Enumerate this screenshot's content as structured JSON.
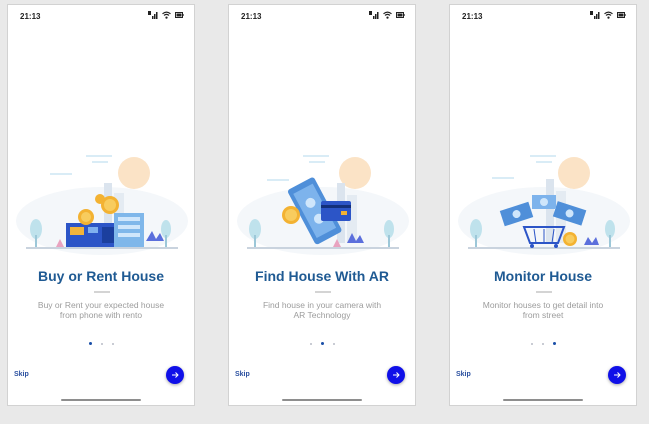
{
  "status": {
    "time": "21:13",
    "icons": [
      "sim-icon",
      "signal-icon",
      "wifi-icon",
      "battery-icon"
    ]
  },
  "colors": {
    "title": "#1f5a93",
    "accent_button": "#1010e8",
    "active_dot": "#1a4fa8",
    "skip": "#2a4fa0"
  },
  "screens": [
    {
      "title": "Buy or Rent House",
      "subtitle_line1": "Buy or Rent your expected house",
      "subtitle_line2": "from phone with rento",
      "active_page": 1,
      "illustration": "house-purchase-illustration"
    },
    {
      "title": "Find House With AR",
      "subtitle_line1": "Find house in your camera with",
      "subtitle_line2": "AR Technology",
      "active_page": 2,
      "illustration": "ar-card-illustration"
    },
    {
      "title": "Monitor House",
      "subtitle_line1": "Monitor houses to get detail into",
      "subtitle_line2": "from street",
      "active_page": 3,
      "illustration": "house-monitor-illustration"
    }
  ],
  "pagination": {
    "total_pages": 3
  },
  "controls": {
    "skip_label": "Skip",
    "next_icon": "arrow-right-icon"
  }
}
